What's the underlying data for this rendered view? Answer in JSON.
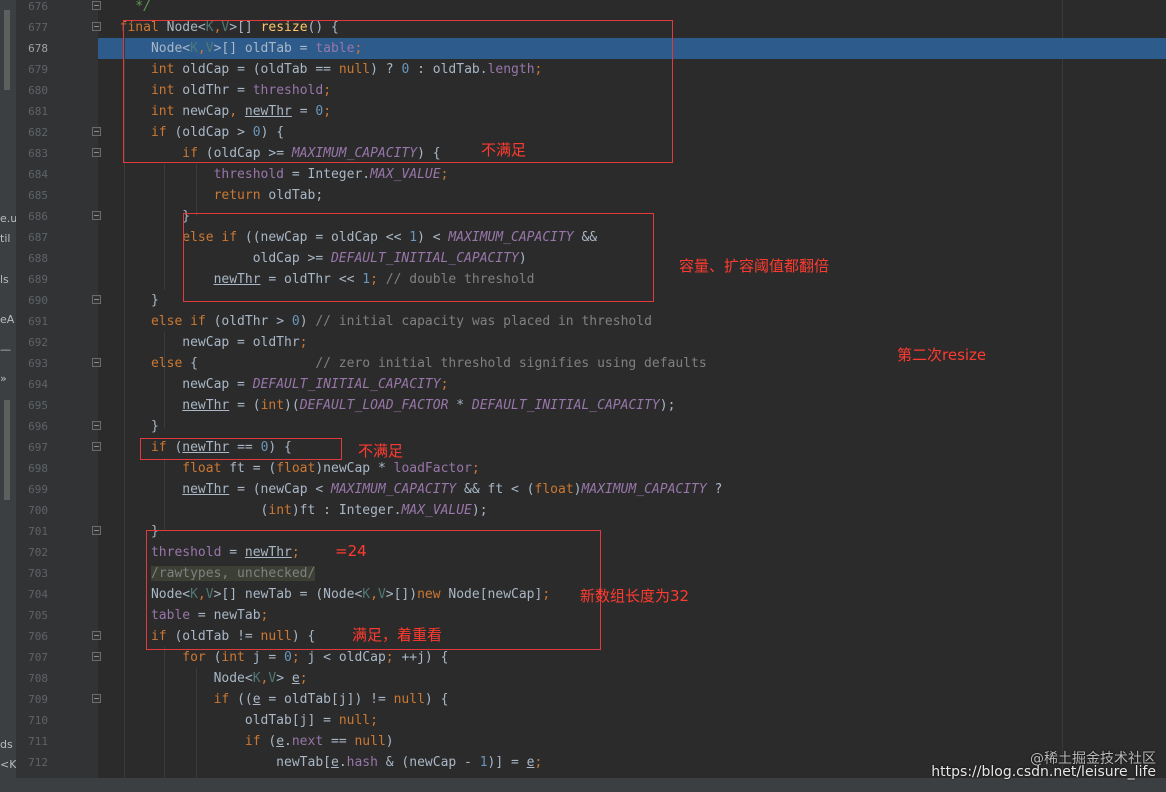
{
  "left_strip": {
    "labels": [
      "e.u",
      "til",
      "ls",
      "eA",
      "—",
      "»",
      "ds",
      "<K"
    ]
  },
  "colors": {
    "keyword": "#cc7832",
    "field": "#9876aa",
    "number": "#6897bb",
    "comment": "#808080",
    "plain": "#a9b7c6",
    "method": "#ffc66d",
    "generic": "#507874",
    "annotation_red": "#ff3b30",
    "selection": "#2d5b8c"
  },
  "editor": {
    "current_line": "678",
    "lines": [
      {
        "n": "676",
        "fold": true,
        "tokens": [
          {
            "t": "    */",
            "c": "doc"
          }
        ]
      },
      {
        "n": "677",
        "fold": true,
        "tokens": [
          {
            "t": "  final ",
            "c": "kw"
          },
          {
            "t": "Node<",
            "c": "p"
          },
          {
            "t": "K",
            "c": "g"
          },
          {
            "t": ",",
            "c": "kw"
          },
          {
            "t": "V",
            "c": "g"
          },
          {
            "t": ">[] ",
            "c": "p"
          },
          {
            "t": "resize",
            "c": "m"
          },
          {
            "t": "() {",
            "c": "p"
          }
        ]
      },
      {
        "n": "678",
        "fold": false,
        "tokens": [
          {
            "t": "      Node<",
            "c": "p"
          },
          {
            "t": "K",
            "c": "g"
          },
          {
            "t": ",",
            "c": "kw"
          },
          {
            "t": "V",
            "c": "g"
          },
          {
            "t": ">[] oldTab = ",
            "c": "p"
          },
          {
            "t": "table",
            "c": "f"
          },
          {
            "t": ";",
            "c": "kw"
          }
        ]
      },
      {
        "n": "679",
        "fold": false,
        "tokens": [
          {
            "t": "      int ",
            "c": "kw"
          },
          {
            "t": "oldCap = (oldTab == ",
            "c": "p"
          },
          {
            "t": "null",
            "c": "kw"
          },
          {
            "t": ") ? ",
            "c": "p"
          },
          {
            "t": "0",
            "c": "n"
          },
          {
            "t": " : oldTab.",
            "c": "p"
          },
          {
            "t": "length",
            "c": "f"
          },
          {
            "t": ";",
            "c": "kw"
          }
        ]
      },
      {
        "n": "680",
        "fold": false,
        "tokens": [
          {
            "t": "      int ",
            "c": "kw"
          },
          {
            "t": "oldThr = ",
            "c": "p"
          },
          {
            "t": "threshold",
            "c": "f"
          },
          {
            "t": ";",
            "c": "kw"
          }
        ]
      },
      {
        "n": "681",
        "fold": false,
        "tokens": [
          {
            "t": "      int ",
            "c": "kw"
          },
          {
            "t": "newCap",
            "c": "p"
          },
          {
            "t": ", ",
            "c": "kw"
          },
          {
            "t": "newThr",
            "c": "u"
          },
          {
            "t": " = ",
            "c": "p"
          },
          {
            "t": "0",
            "c": "n"
          },
          {
            "t": ";",
            "c": "kw"
          }
        ]
      },
      {
        "n": "682",
        "fold": true,
        "tokens": [
          {
            "t": "      if ",
            "c": "kw"
          },
          {
            "t": "(oldCap > ",
            "c": "p"
          },
          {
            "t": "0",
            "c": "n"
          },
          {
            "t": ") {",
            "c": "p"
          }
        ]
      },
      {
        "n": "683",
        "fold": true,
        "tokens": [
          {
            "t": "          if ",
            "c": "kw"
          },
          {
            "t": "(oldCap >= ",
            "c": "p"
          },
          {
            "t": "MAXIMUM_CAPACITY",
            "c": "fi"
          },
          {
            "t": ") {",
            "c": "p"
          }
        ]
      },
      {
        "n": "684",
        "fold": false,
        "tokens": [
          {
            "t": "              threshold",
            "c": "f"
          },
          {
            "t": " = Integer.",
            "c": "p"
          },
          {
            "t": "MAX_VALUE",
            "c": "fi"
          },
          {
            "t": ";",
            "c": "kw"
          }
        ]
      },
      {
        "n": "685",
        "fold": false,
        "tokens": [
          {
            "t": "              return ",
            "c": "kw"
          },
          {
            "t": "oldTab;",
            "c": "p"
          }
        ]
      },
      {
        "n": "686",
        "fold": true,
        "tokens": [
          {
            "t": "          }",
            "c": "p"
          }
        ]
      },
      {
        "n": "687",
        "fold": false,
        "tokens": [
          {
            "t": "          else if ",
            "c": "kw"
          },
          {
            "t": "((newCap = oldCap << ",
            "c": "p"
          },
          {
            "t": "1",
            "c": "n"
          },
          {
            "t": ") < ",
            "c": "p"
          },
          {
            "t": "MAXIMUM_CAPACITY",
            "c": "fi"
          },
          {
            "t": " &&",
            "c": "p"
          }
        ]
      },
      {
        "n": "688",
        "fold": false,
        "tokens": [
          {
            "t": "                   oldCap >= ",
            "c": "p"
          },
          {
            "t": "DEFAULT_INITIAL_CAPACITY",
            "c": "fi"
          },
          {
            "t": ")",
            "c": "p"
          }
        ]
      },
      {
        "n": "689",
        "fold": false,
        "tokens": [
          {
            "t": "              ",
            "c": "p"
          },
          {
            "t": "newThr",
            "c": "u"
          },
          {
            "t": " = oldThr << ",
            "c": "p"
          },
          {
            "t": "1",
            "c": "n"
          },
          {
            "t": "; ",
            "c": "kw"
          },
          {
            "t": "// double threshold",
            "c": "cm"
          }
        ]
      },
      {
        "n": "690",
        "fold": true,
        "tokens": [
          {
            "t": "      }",
            "c": "p"
          }
        ]
      },
      {
        "n": "691",
        "fold": false,
        "tokens": [
          {
            "t": "      else if ",
            "c": "kw"
          },
          {
            "t": "(oldThr > ",
            "c": "p"
          },
          {
            "t": "0",
            "c": "n"
          },
          {
            "t": ") ",
            "c": "p"
          },
          {
            "t": "// initial capacity was placed in threshold",
            "c": "cm"
          }
        ]
      },
      {
        "n": "692",
        "fold": false,
        "tokens": [
          {
            "t": "          newCap = oldThr",
            "c": "p"
          },
          {
            "t": ";",
            "c": "kw"
          }
        ]
      },
      {
        "n": "693",
        "fold": true,
        "tokens": [
          {
            "t": "      else ",
            "c": "kw"
          },
          {
            "t": "{               ",
            "c": "p"
          },
          {
            "t": "// zero initial threshold signifies using defaults",
            "c": "cm"
          }
        ]
      },
      {
        "n": "694",
        "fold": false,
        "tokens": [
          {
            "t": "          newCap = ",
            "c": "p"
          },
          {
            "t": "DEFAULT_INITIAL_CAPACITY",
            "c": "fi"
          },
          {
            "t": ";",
            "c": "kw"
          }
        ]
      },
      {
        "n": "695",
        "fold": false,
        "tokens": [
          {
            "t": "          ",
            "c": "p"
          },
          {
            "t": "newThr",
            "c": "u"
          },
          {
            "t": " = (",
            "c": "p"
          },
          {
            "t": "int",
            "c": "kw"
          },
          {
            "t": ")(",
            "c": "p"
          },
          {
            "t": "DEFAULT_LOAD_FACTOR",
            "c": "fi"
          },
          {
            "t": " * ",
            "c": "p"
          },
          {
            "t": "DEFAULT_INITIAL_CAPACITY",
            "c": "fi"
          },
          {
            "t": ");",
            "c": "p"
          }
        ]
      },
      {
        "n": "696",
        "fold": true,
        "tokens": [
          {
            "t": "      }",
            "c": "p"
          }
        ]
      },
      {
        "n": "697",
        "fold": true,
        "tokens": [
          {
            "t": "      if ",
            "c": "kw"
          },
          {
            "t": "(",
            "c": "p"
          },
          {
            "t": "newThr",
            "c": "u"
          },
          {
            "t": " == ",
            "c": "p"
          },
          {
            "t": "0",
            "c": "n"
          },
          {
            "t": ") {",
            "c": "p"
          }
        ]
      },
      {
        "n": "698",
        "fold": false,
        "tokens": [
          {
            "t": "          float ",
            "c": "kw"
          },
          {
            "t": "ft = (",
            "c": "p"
          },
          {
            "t": "float",
            "c": "kw"
          },
          {
            "t": ")newCap * ",
            "c": "p"
          },
          {
            "t": "loadFactor",
            "c": "f"
          },
          {
            "t": ";",
            "c": "kw"
          }
        ]
      },
      {
        "n": "699",
        "fold": false,
        "tokens": [
          {
            "t": "          ",
            "c": "p"
          },
          {
            "t": "newThr",
            "c": "u"
          },
          {
            "t": " = (newCap < ",
            "c": "p"
          },
          {
            "t": "MAXIMUM_CAPACITY",
            "c": "fi"
          },
          {
            "t": " && ft < (",
            "c": "p"
          },
          {
            "t": "float",
            "c": "kw"
          },
          {
            "t": ")",
            "c": "p"
          },
          {
            "t": "MAXIMUM_CAPACITY",
            "c": "fi"
          },
          {
            "t": " ?",
            "c": "p"
          }
        ]
      },
      {
        "n": "700",
        "fold": false,
        "tokens": [
          {
            "t": "                    (",
            "c": "p"
          },
          {
            "t": "int",
            "c": "kw"
          },
          {
            "t": ")ft : Integer.",
            "c": "p"
          },
          {
            "t": "MAX_VALUE",
            "c": "fi"
          },
          {
            "t": ");",
            "c": "p"
          }
        ]
      },
      {
        "n": "701",
        "fold": true,
        "tokens": [
          {
            "t": "      }",
            "c": "p"
          }
        ]
      },
      {
        "n": "702",
        "fold": false,
        "tokens": [
          {
            "t": "      threshold",
            "c": "f"
          },
          {
            "t": " = ",
            "c": "p"
          },
          {
            "t": "newThr",
            "c": "u"
          },
          {
            "t": ";",
            "c": "kw"
          }
        ]
      },
      {
        "n": "703",
        "fold": false,
        "tokens": [
          {
            "t": "      ",
            "c": "p"
          },
          {
            "t": "/rawtypes, unchecked/",
            "c": "ann"
          }
        ]
      },
      {
        "n": "704",
        "fold": false,
        "tokens": [
          {
            "t": "      Node<",
            "c": "p"
          },
          {
            "t": "K",
            "c": "g"
          },
          {
            "t": ",",
            "c": "kw"
          },
          {
            "t": "V",
            "c": "g"
          },
          {
            "t": ">[] newTab = (Node<",
            "c": "p"
          },
          {
            "t": "K",
            "c": "g"
          },
          {
            "t": ",",
            "c": "kw"
          },
          {
            "t": "V",
            "c": "g"
          },
          {
            "t": ">[])",
            "c": "p"
          },
          {
            "t": "new ",
            "c": "kw"
          },
          {
            "t": "Node[newCap]",
            "c": "p"
          },
          {
            "t": ";",
            "c": "kw"
          }
        ]
      },
      {
        "n": "705",
        "fold": false,
        "tokens": [
          {
            "t": "      table",
            "c": "f"
          },
          {
            "t": " = newTab",
            "c": "p"
          },
          {
            "t": ";",
            "c": "kw"
          }
        ]
      },
      {
        "n": "706",
        "fold": true,
        "tokens": [
          {
            "t": "      if ",
            "c": "kw"
          },
          {
            "t": "(oldTab != ",
            "c": "p"
          },
          {
            "t": "null",
            "c": "kw"
          },
          {
            "t": ") {",
            "c": "p"
          }
        ]
      },
      {
        "n": "707",
        "fold": true,
        "tokens": [
          {
            "t": "          for ",
            "c": "kw"
          },
          {
            "t": "(",
            "c": "p"
          },
          {
            "t": "int ",
            "c": "kw"
          },
          {
            "t": "j = ",
            "c": "p"
          },
          {
            "t": "0",
            "c": "n"
          },
          {
            "t": "; ",
            "c": "kw"
          },
          {
            "t": "j < oldCap",
            "c": "p"
          },
          {
            "t": "; ",
            "c": "kw"
          },
          {
            "t": "++j) {",
            "c": "p"
          }
        ]
      },
      {
        "n": "708",
        "fold": false,
        "tokens": [
          {
            "t": "              Node<",
            "c": "p"
          },
          {
            "t": "K",
            "c": "g"
          },
          {
            "t": ",",
            "c": "kw"
          },
          {
            "t": "V",
            "c": "g"
          },
          {
            "t": "> ",
            "c": "p"
          },
          {
            "t": "e",
            "c": "u"
          },
          {
            "t": ";",
            "c": "kw"
          }
        ]
      },
      {
        "n": "709",
        "fold": true,
        "tokens": [
          {
            "t": "              if ",
            "c": "kw"
          },
          {
            "t": "((",
            "c": "p"
          },
          {
            "t": "e",
            "c": "u"
          },
          {
            "t": " = oldTab[j]) != ",
            "c": "p"
          },
          {
            "t": "null",
            "c": "kw"
          },
          {
            "t": ") {",
            "c": "p"
          }
        ]
      },
      {
        "n": "710",
        "fold": false,
        "tokens": [
          {
            "t": "                  oldTab[j] = ",
            "c": "p"
          },
          {
            "t": "null",
            "c": "kw"
          },
          {
            "t": ";",
            "c": "kw"
          }
        ]
      },
      {
        "n": "711",
        "fold": false,
        "tokens": [
          {
            "t": "                  if ",
            "c": "kw"
          },
          {
            "t": "(",
            "c": "p"
          },
          {
            "t": "e",
            "c": "u"
          },
          {
            "t": ".",
            "c": "p"
          },
          {
            "t": "next",
            "c": "f"
          },
          {
            "t": " == ",
            "c": "p"
          },
          {
            "t": "null",
            "c": "kw"
          },
          {
            "t": ")",
            "c": "p"
          }
        ]
      },
      {
        "n": "712",
        "fold": false,
        "tokens": [
          {
            "t": "                      newTab[",
            "c": "p"
          },
          {
            "t": "e",
            "c": "u"
          },
          {
            "t": ".",
            "c": "p"
          },
          {
            "t": "hash",
            "c": "f"
          },
          {
            "t": " & (newCap - ",
            "c": "p"
          },
          {
            "t": "1",
            "c": "n"
          },
          {
            "t": ")] = ",
            "c": "p"
          },
          {
            "t": "e",
            "c": "u"
          },
          {
            "t": ";",
            "c": "kw"
          }
        ]
      }
    ]
  },
  "annotations": {
    "not_satisfied_1": "不满足",
    "capacity_threshold_doubled": "容量、扩容阈值都翻倍",
    "second_resize": "第二次resize",
    "not_satisfied_2": "不满足",
    "equals_24": "=24",
    "new_array_length_32": "新数组长度为32",
    "satisfied_look_again": "满足，着重看"
  },
  "watermark": {
    "line1": "@稀土掘金技术社区",
    "line2": "https://blog.csdn.net/leisure_life"
  }
}
